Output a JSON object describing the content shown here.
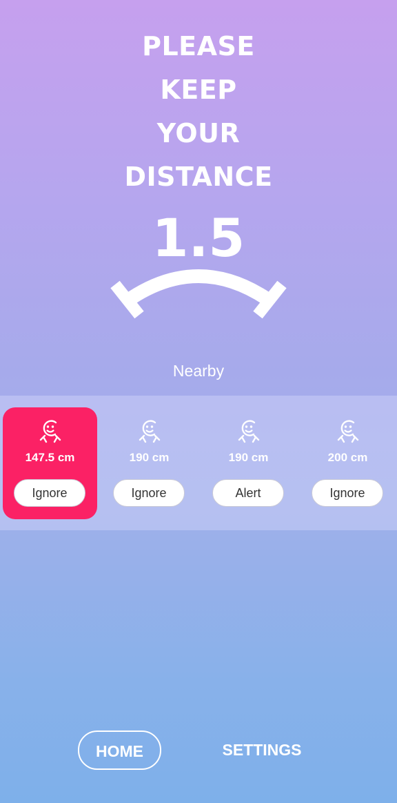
{
  "headline": {
    "lines": [
      "PLEASE",
      "KEEP",
      "YOUR",
      "DISTANCE"
    ]
  },
  "distance": {
    "value": "1.5"
  },
  "nearby": {
    "label": "Nearby",
    "devices": [
      {
        "distance": "147.5 cm",
        "action": "Ignore",
        "alerting": true
      },
      {
        "distance": "190 cm",
        "action": "Ignore",
        "alerting": false
      },
      {
        "distance": "190 cm",
        "action": "Alert",
        "alerting": false
      },
      {
        "distance": "200 cm",
        "action": "Ignore",
        "alerting": false
      }
    ]
  },
  "nav": {
    "home": "HOME",
    "settings": "SETTINGS"
  },
  "colors": {
    "alert_card": "#fb2165",
    "text": "#ffffff"
  },
  "icons": {
    "gauge": "distance-gauge-arc",
    "device": "person-smile-icon"
  }
}
